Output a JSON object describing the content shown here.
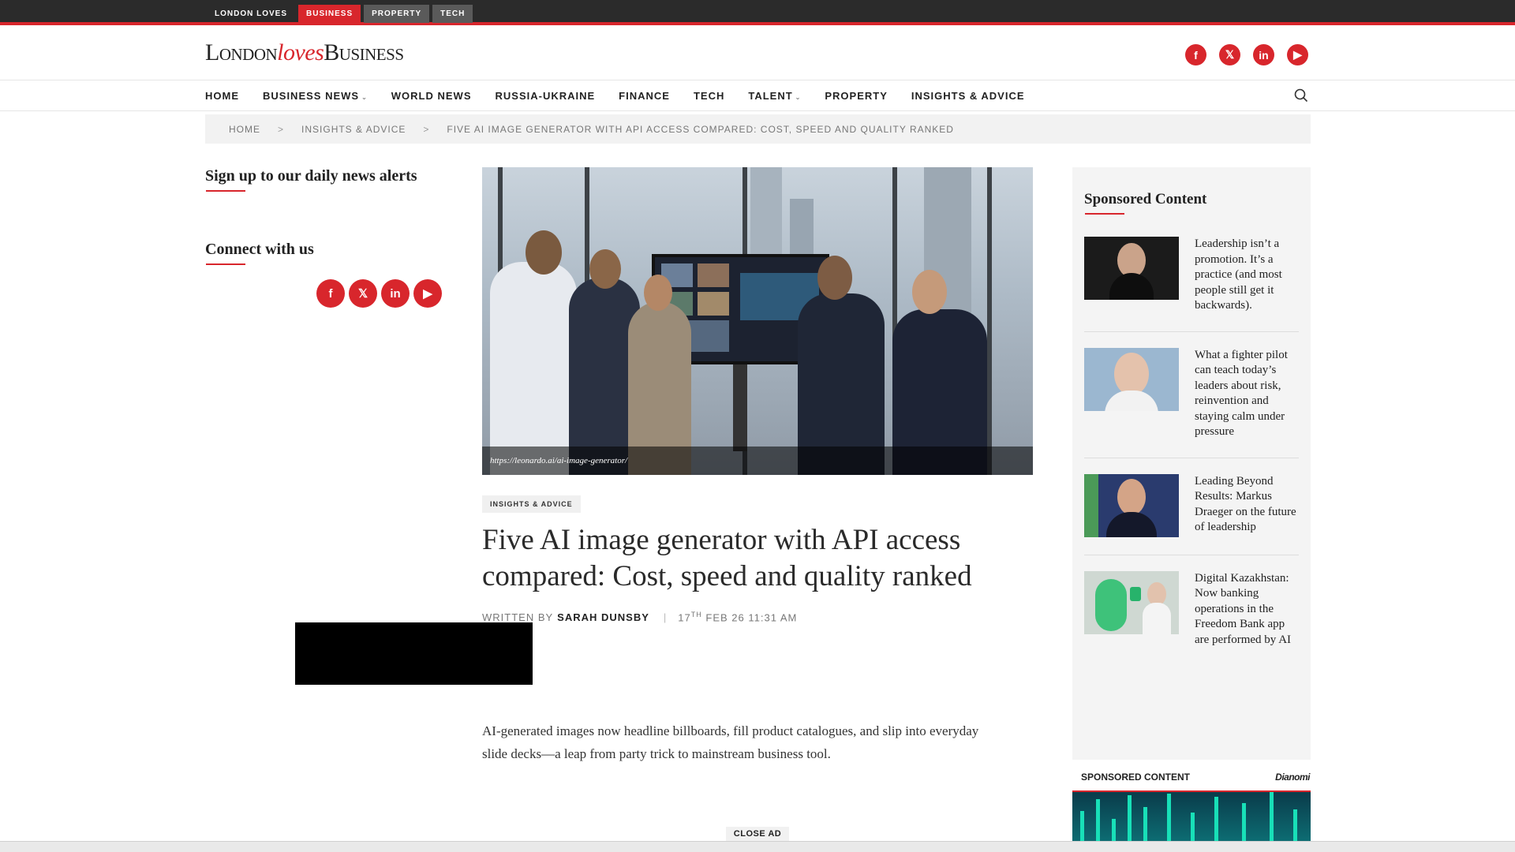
{
  "topbar": {
    "items": [
      {
        "label": "LONDON LOVES"
      },
      {
        "label": "BUSINESS"
      },
      {
        "label": "PROPERTY"
      },
      {
        "label": "TECH"
      }
    ]
  },
  "header": {
    "logo": {
      "part1": "London",
      "part2": "loves",
      "part3": "Business"
    },
    "social": [
      "f",
      "𝕏",
      "in",
      "▶"
    ]
  },
  "nav": {
    "items": [
      {
        "label": "HOME"
      },
      {
        "label": "BUSINESS NEWS"
      },
      {
        "label": "WORLD NEWS"
      },
      {
        "label": "RUSSIA-UKRAINE"
      },
      {
        "label": "FINANCE"
      },
      {
        "label": "TECH"
      },
      {
        "label": "TALENT"
      },
      {
        "label": "PROPERTY"
      },
      {
        "label": "INSIGHTS & ADVICE"
      }
    ],
    "caret": "⌄"
  },
  "breadcrumb": {
    "home": "HOME",
    "section": "INSIGHTS & ADVICE",
    "current": "FIVE AI IMAGE GENERATOR WITH API ACCESS COMPARED: COST, SPEED AND QUALITY RANKED",
    "sep": ">"
  },
  "left": {
    "signup_title": "Sign up to our daily news alerts",
    "connect_title": "Connect with us"
  },
  "article": {
    "image_caption": "https://leonardo.ai/ai-image-generator/",
    "category": "INSIGHTS & ADVICE",
    "title": "Five AI image generator with API access compared: Cost, speed and quality ranked",
    "written_by": "WRITTEN BY",
    "author": "SARAH DUNSBY",
    "pipe": "|",
    "date_day": "17",
    "date_suffix": "TH",
    "date_rest": "FEB 26 11:31 AM",
    "intro": "AI-generated images now headline billboards, fill product catalogues, and slip into everyday slide decks—a leap from party trick to mainstream business tool."
  },
  "sidebar": {
    "title": "Sponsored Content",
    "items": [
      {
        "text": "Leadership isn’t a promotion. It’s a practice (and most people still get it backwards)."
      },
      {
        "text": "What a fighter pilot can teach today’s leaders about risk, reinvention and staying calm under pressure"
      },
      {
        "text": "Leading Beyond Results: Markus Draeger on the future of leadership"
      },
      {
        "text": "Digital Kazakhstan: Now banking operations in the Freedom Bank app are performed by AI"
      }
    ],
    "footer_label": "SPONSORED CONTENT",
    "footer_brand": "Dianomi"
  },
  "ad": {
    "close_label": "CLOSE AD"
  },
  "colors": {
    "accent": "#d8262c",
    "topbar": "#2b2b2b"
  }
}
